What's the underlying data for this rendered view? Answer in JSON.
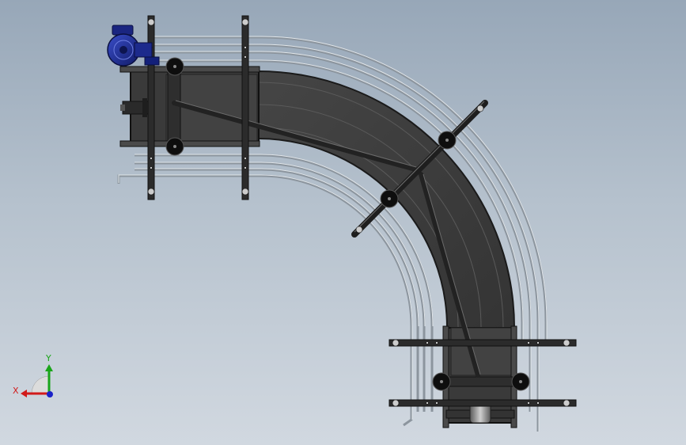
{
  "viewport": {
    "background_top": "#97a7b8",
    "background_bottom": "#d1d8e0"
  },
  "model": {
    "belt_color": "#3d3d3d",
    "frame_color": "#2a2a2a",
    "guide_rail_color": "#9aa3ac",
    "motor_color": "#1c2a8c"
  },
  "triad": {
    "x_label": "X",
    "y_label": "Y",
    "x_color": "#d11a1a",
    "y_color": "#1aa51a",
    "z_color": "#1a22c8"
  }
}
